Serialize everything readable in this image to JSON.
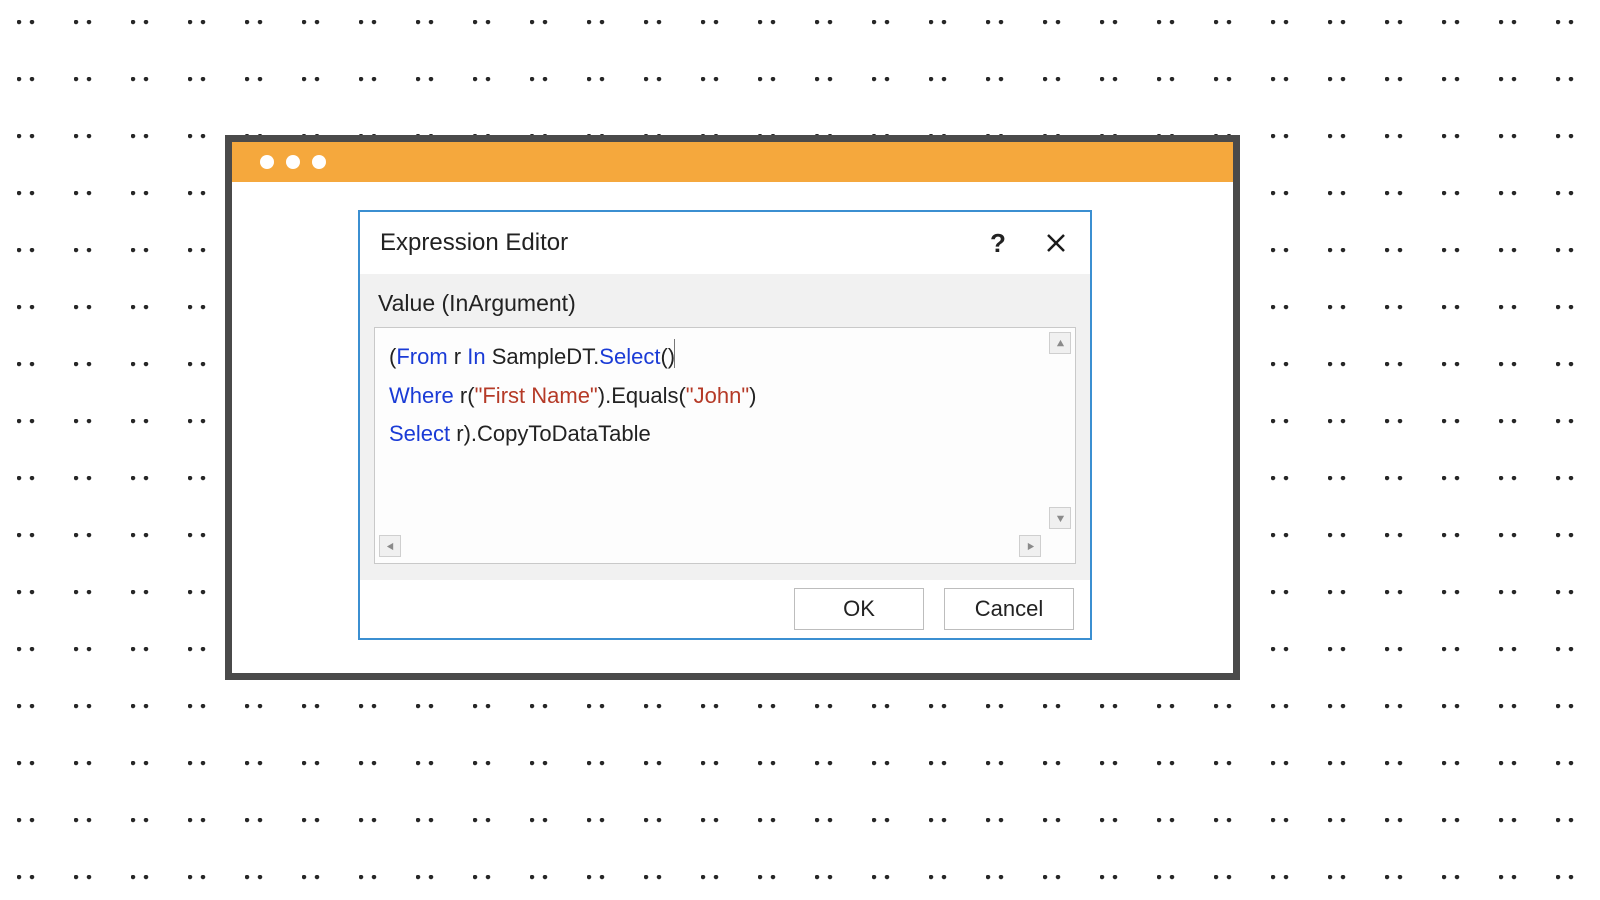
{
  "dialog": {
    "title": "Expression Editor",
    "help": "?",
    "field_label": "Value (InArgument)",
    "code": {
      "line1": {
        "k1": "From",
        "t1": " r ",
        "k2": "In",
        "t2": " SampleDT.",
        "k3": "Select",
        "t3": "()"
      },
      "line2": {
        "k1": "Where",
        "t1": " r(",
        "s1": "\"First Name\"",
        "t2": ").Equals(",
        "s2": "\"John\"",
        "t3": ")"
      },
      "line3": {
        "k1": "Select",
        "t1": " r).CopyToDataTable"
      }
    },
    "buttons": {
      "ok": "OK",
      "cancel": "Cancel"
    }
  }
}
